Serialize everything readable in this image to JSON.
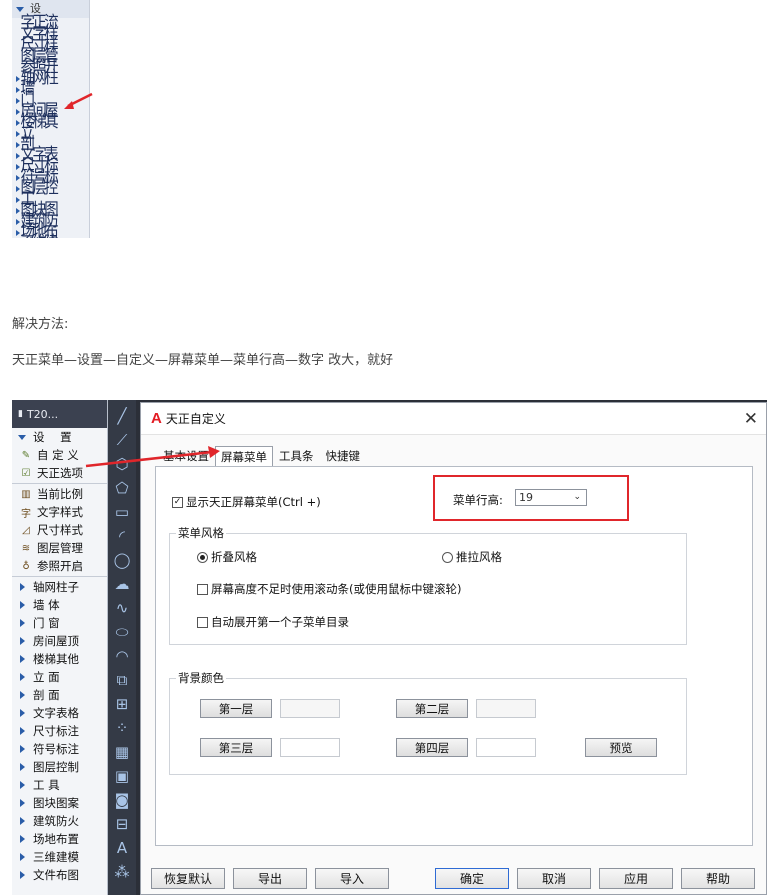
{
  "garbled_panel": {
    "header": "设",
    "lines": [
      "字正流",
      "文字样",
      "尺寸样",
      "图层管",
      "参照开",
      "轴网柱",
      "墙",
      "门",
      "房间屋",
      "楼梯其",
      "立",
      "剖",
      "文字表",
      "尺寸标",
      "符号标",
      "图层控",
      "工",
      "图块图",
      "建筑防",
      "场地布",
      "三维建",
      "文件布"
    ]
  },
  "instructions": {
    "solution_label": "解决方法:",
    "steps": "天正菜单—设置—自定义—屏幕菜单—菜单行高—数字    改大，就好"
  },
  "left_panel": {
    "title": "T20...",
    "header_item": "设 置",
    "subitems": [
      {
        "label": "自 定 义",
        "icon": "customize-icon"
      },
      {
        "label": "天正选项",
        "icon": "options-icon"
      }
    ],
    "tools": [
      {
        "label": "当前比例",
        "icon": "scale-icon"
      },
      {
        "label": "文字样式",
        "icon": "text-style-icon"
      },
      {
        "label": "尺寸样式",
        "icon": "dim-style-icon"
      },
      {
        "label": "图层管理",
        "icon": "layer-icon"
      },
      {
        "label": "参照开启",
        "icon": "bulb-icon"
      }
    ],
    "menus": [
      "轴网柱子",
      "墙 体",
      "门 窗",
      "房间屋顶",
      "楼梯其他",
      "立 面",
      "剖 面",
      "文字表格",
      "尺寸标注",
      "符号标注",
      "图层控制",
      "工 具",
      "图块图案",
      "建筑防火",
      "场地布置",
      "三维建模",
      "文件布图"
    ]
  },
  "dialog": {
    "title": "天正自定义",
    "logo": "A",
    "tabs": [
      "基本设置",
      "屏幕菜单",
      "工具条",
      "快捷键"
    ],
    "active_tab": 1,
    "show_screen_menu": "显示天正屏幕菜单(Ctrl +)",
    "row_height_label": "菜单行高:",
    "row_height_value": "19",
    "menu_style_group": "菜单风格",
    "style_fold": "折叠风格",
    "style_push": "推拉风格",
    "scrollbar_option": "屏幕高度不足时使用滚动条(或使用鼠标中键滚轮)",
    "auto_expand_option": "自动展开第一个子菜单目录",
    "bg_color_group": "背景颜色",
    "layer_buttons": [
      "第一层",
      "第二层",
      "第三层",
      "第四层"
    ],
    "preview": "预览",
    "footer": [
      "恢复默认",
      "导出",
      "导入",
      "确定",
      "取消",
      "应用",
      "帮助"
    ]
  },
  "colors": {
    "highlight": "#e0262b",
    "brand": "#e31b23",
    "toolbar": "#343a46"
  }
}
